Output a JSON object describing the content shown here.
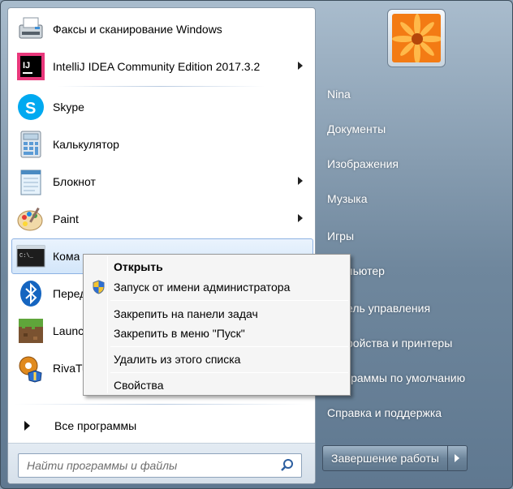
{
  "programs": [
    {
      "label": "Факсы и сканирование Windows",
      "icon": "fax-scanner-icon",
      "arrow": false
    },
    {
      "label": "IntelliJ IDEA Community Edition 2017.3.2",
      "icon": "intellij-idea-icon",
      "arrow": true
    },
    {
      "label": "Skype",
      "icon": "skype-icon",
      "arrow": false
    },
    {
      "label": "Калькулятор",
      "icon": "calculator-icon",
      "arrow": false
    },
    {
      "label": "Блокнот",
      "icon": "notepad-icon",
      "arrow": true
    },
    {
      "label": "Paint",
      "icon": "paint-icon",
      "arrow": true
    },
    {
      "label": "Кома",
      "icon": "command-prompt-icon",
      "arrow": false
    },
    {
      "label": "Перед",
      "icon": "bluetooth-icon",
      "arrow": false
    },
    {
      "label": "Launch",
      "icon": "minecraft-launcher-icon",
      "arrow": false
    },
    {
      "label": "RivaTu",
      "icon": "rivatuner-icon",
      "arrow": false
    }
  ],
  "all_programs": "Все программы",
  "search": {
    "placeholder": "Найти программы и файлы"
  },
  "right": {
    "items": [
      "Nina",
      "Документы",
      "Изображения",
      "Музыка",
      "Игры",
      "пьютер",
      "ель управления",
      "ройства и принтеры",
      "граммы по умолчанию",
      "Справка и поддержка"
    ]
  },
  "shutdown": {
    "label": "Завершение работы"
  },
  "context_menu": {
    "open": "Открыть",
    "run_as_admin": "Запуск от имени администратора",
    "pin_taskbar": "Закрепить на панели задач",
    "pin_start": "Закрепить в меню \"Пуск\"",
    "remove": "Удалить из этого списка",
    "properties": "Свойства"
  },
  "colors": {
    "highlight": "#d3e6fa",
    "accent_border": "#8db2e3",
    "right_panel": "#6f879d"
  }
}
